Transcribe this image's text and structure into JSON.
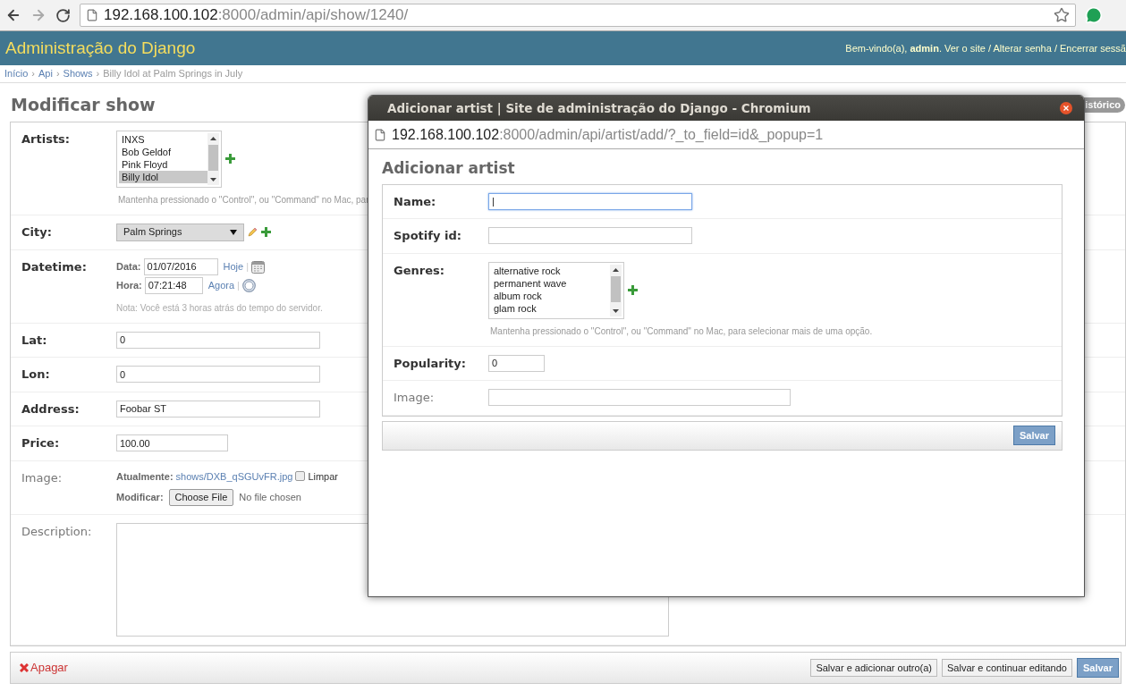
{
  "browser": {
    "url_host": "192.168.100.102",
    "url_path": ":8000/admin/api/show/1240/"
  },
  "header": {
    "site_title": "Administração do Django",
    "user_tools": "Bem-vindo(a), **admin**. Ver o site / Alterar senha / Encerrar sessã"
  },
  "breadcrumbs": [
    {
      "kind": "link",
      "label": "Início"
    },
    {
      "kind": "separator",
      "label": "›"
    },
    {
      "kind": "link",
      "label": "Api"
    },
    {
      "kind": "separator",
      "label": "›"
    },
    {
      "kind": "link",
      "label": "Shows"
    },
    {
      "kind": "separator",
      "label": "›"
    },
    {
      "kind": "current",
      "label": "Billy Idol at Palm Springs in July"
    }
  ],
  "page_title": "Modificar show",
  "history_button": "istórico",
  "fields": [
    {
      "kind": "multiselect",
      "label": "Artists:",
      "required": true,
      "options": [
        {
          "label": "INXS",
          "selected": false
        },
        {
          "label": "Bob Geldof",
          "selected": false
        },
        {
          "label": "Pink Floyd",
          "selected": false
        },
        {
          "label": "Billy Idol",
          "selected": true
        }
      ],
      "help": "Mantenha pressionado o \"Control\", ou \"Command\" no Mac, par"
    },
    {
      "kind": "select",
      "label": "City:",
      "required": true,
      "value": "Palm Springs"
    },
    {
      "kind": "datetime",
      "label": "Datetime:",
      "required": true,
      "date_label": "Data:",
      "date_value": "01/07/2016",
      "date_link": "Hoje",
      "date_separator": "|",
      "time_label": "Hora:",
      "time_value": "07:21:48",
      "time_link": "Agora",
      "time_separator": "|",
      "note": "Nota: Você está 3 horas atrás do tempo do servidor."
    },
    {
      "kind": "text",
      "label": "Lat:",
      "required": true,
      "value": "0"
    },
    {
      "kind": "text",
      "label": "Lon:",
      "required": true,
      "value": "0"
    },
    {
      "kind": "text",
      "label": "Address:",
      "required": true,
      "value": "Foobar ST"
    },
    {
      "kind": "medium_text",
      "label": "Price:",
      "required": true,
      "value": "100.00"
    },
    {
      "kind": "file",
      "label": "Image:",
      "required": false,
      "current_label": "Atualmente:",
      "current_link": "shows/DXB_qSGUvFR.jpg",
      "clear_checked": false,
      "clear_label": "Limpar",
      "change_label": "Modificar:",
      "choose_button": "Choose File",
      "file_status": "No file chosen"
    },
    {
      "kind": "textarea",
      "label": "Description:",
      "required": false
    }
  ],
  "footer": {
    "delete_link": "Apagar",
    "buttons": [
      {
        "label": "Salvar e adicionar outro(a)",
        "primary": false
      },
      {
        "label": "Salvar e continuar editando",
        "primary": false
      },
      {
        "label": "Salvar",
        "primary": true
      }
    ]
  },
  "popup": {
    "window_title": "Adicionar artist | Site de administração do Django - Chromium",
    "url_host": "192.168.100.102",
    "url_path": ":8000/admin/api/artist/add/?_to_field=id&_popup=1",
    "heading": "Adicionar artist",
    "fields": [
      {
        "kind": "text",
        "label": "Name:",
        "required": true,
        "value": "|",
        "focused": true
      },
      {
        "kind": "text",
        "label": "Spotify id:",
        "required": true,
        "focused": false
      },
      {
        "kind": "multiselect",
        "label": "Genres:",
        "required": true,
        "options": [
          {
            "label": "alternative rock",
            "selected": false
          },
          {
            "label": "permanent wave",
            "selected": false
          },
          {
            "label": "album rock",
            "selected": false
          },
          {
            "label": "glam rock",
            "selected": false
          }
        ],
        "help": "Mantenha pressionado o \"Control\", ou \"Command\" no Mac, para selecionar mais de uma opção."
      },
      {
        "kind": "short_text",
        "label": "Popularity:",
        "required": true,
        "value": "0",
        "focused": false
      },
      {
        "kind": "wide_text",
        "label": "Image:",
        "required": false,
        "focused": false
      }
    ],
    "save_button": "Salvar"
  }
}
